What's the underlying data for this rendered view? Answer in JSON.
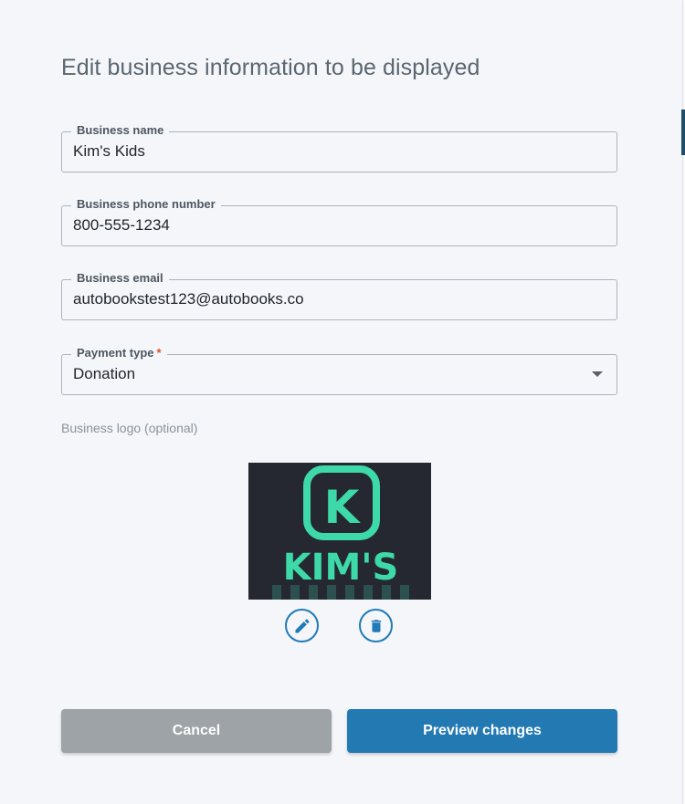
{
  "dialog": {
    "title": "Edit business information to be displayed"
  },
  "form": {
    "business_name": {
      "label": "Business name",
      "value": "Kim's Kids"
    },
    "business_phone": {
      "label": "Business phone number",
      "value": "800-555-1234"
    },
    "business_email": {
      "label": "Business email",
      "value": "autobookstest123@autobooks.co"
    },
    "payment_type": {
      "label": "Payment type",
      "required_marker": "*",
      "selected": "Donation"
    },
    "logo": {
      "label": "Business logo (optional)",
      "image_text": "KIM'S",
      "monogram": "K",
      "edit_icon": "pencil-icon",
      "delete_icon": "trash-icon"
    }
  },
  "actions": {
    "cancel_label": "Cancel",
    "preview_label": "Preview changes"
  },
  "colors": {
    "panel_background": "#f4f6fa",
    "primary": "#237ab3",
    "cancel": "#9da3a6",
    "required": "#e0502a",
    "logo_background": "#252830",
    "logo_accent": "#3dd9a8"
  }
}
